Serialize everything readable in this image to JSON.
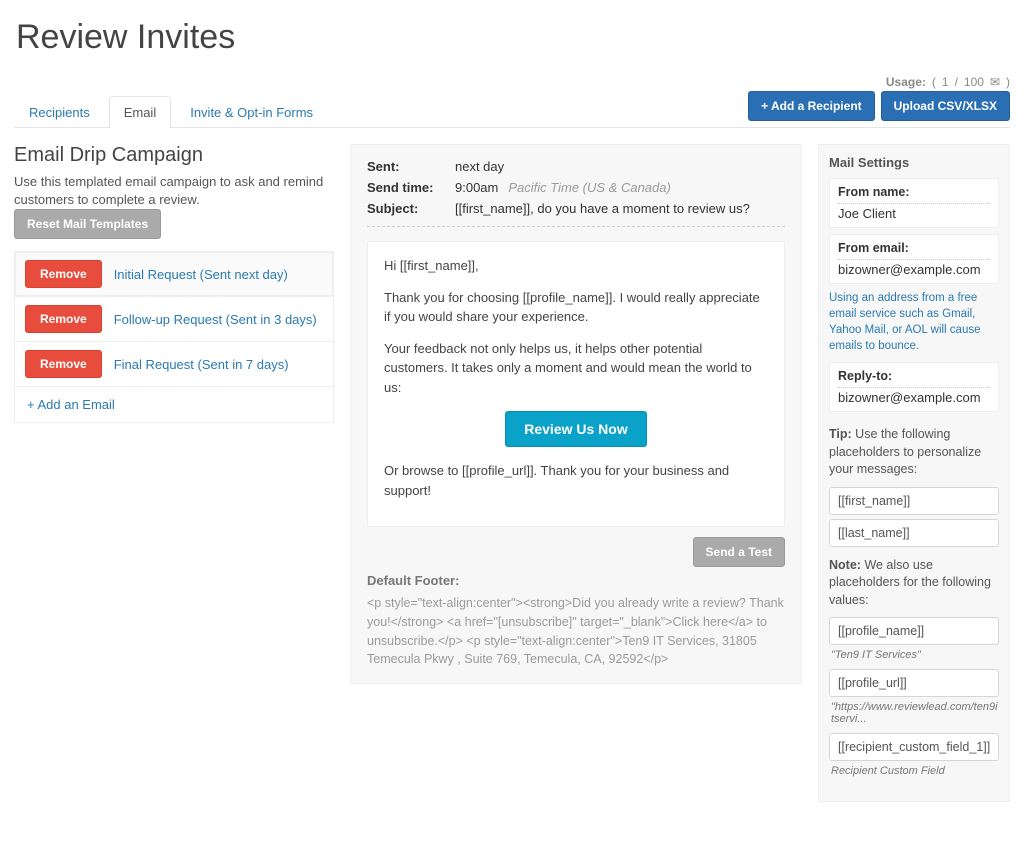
{
  "page_title": "Review Invites",
  "usage": {
    "label": "Usage:",
    "current": "1",
    "sep": "/",
    "max": "100"
  },
  "tabs": [
    {
      "label": "Recipients",
      "active": false
    },
    {
      "label": "Email",
      "active": true
    },
    {
      "label": "Invite & Opt-in Forms",
      "active": false
    }
  ],
  "buttons": {
    "add_recipient": "+ Add a Recipient",
    "upload": "Upload CSV/XLSX",
    "reset": "Reset Mail Templates",
    "remove": "Remove",
    "add_email": "+ Add an Email",
    "review_now": "Review Us Now",
    "send_test": "Send a Test"
  },
  "left": {
    "heading": "Email Drip Campaign",
    "description": "Use this templated email campaign to ask and remind customers to complete a review.",
    "emails": [
      {
        "label": "Initial Request (Sent next day)",
        "selected": true
      },
      {
        "label": "Follow-up Request (Sent in 3 days)",
        "selected": false
      },
      {
        "label": "Final Request (Sent in 7 days)",
        "selected": false
      }
    ]
  },
  "mid": {
    "sent_label": "Sent:",
    "sent_value": "next day",
    "time_label": "Send time:",
    "time_value": "9:00am",
    "time_tz": "Pacific Time (US & Canada)",
    "subject_label": "Subject:",
    "subject_value": "[[first_name]], do you have a moment to review us?",
    "body": {
      "p1": "Hi [[first_name]],",
      "p2": "Thank you for choosing [[profile_name]]. I would really appreciate if you would share your experience.",
      "p3": "Your feedback not only helps us, it helps other potential customers. It takes only a moment and would mean the world to us:",
      "p4": "Or browse to [[profile_url]]. Thank you for your business and support!"
    },
    "footer_title": "Default Footer:",
    "footer_code": "<p style=\"text-align:center\"><strong>Did you already write a review? Thank you!</strong> <a href=\"[unsubscribe]\" target=\"_blank\">Click here</a> to unsubscribe.</p> <p style=\"text-align:center\">Ten9 IT Services, 31805 Temecula Pkwy , Suite 769, Temecula, CA, 92592</p>"
  },
  "right": {
    "heading": "Mail Settings",
    "from_name_label": "From name:",
    "from_name_value": "Joe Client",
    "from_email_label": "From email:",
    "from_email_value": "bizowner@example.com",
    "email_hint": "Using an address from a free email service such as Gmail, Yahoo Mail, or AOL will cause emails to bounce.",
    "reply_label": "Reply-to:",
    "reply_value": "bizowner@example.com",
    "tip_label": "Tip:",
    "tip_text": "Use the following placeholders to personalize your messages:",
    "placeholders_top": [
      "[[first_name]]",
      "[[last_name]]"
    ],
    "note_label": "Note:",
    "note_text": "We also use placeholders for the following values:",
    "profile_name_ph": "[[profile_name]]",
    "profile_name_note": "\"Ten9 IT Services\"",
    "profile_url_ph": "[[profile_url]]",
    "profile_url_note": "\"https://www.reviewlead.com/ten9itservi...",
    "custom_ph": "[[recipient_custom_field_1]]",
    "custom_note": "Recipient Custom Field"
  }
}
